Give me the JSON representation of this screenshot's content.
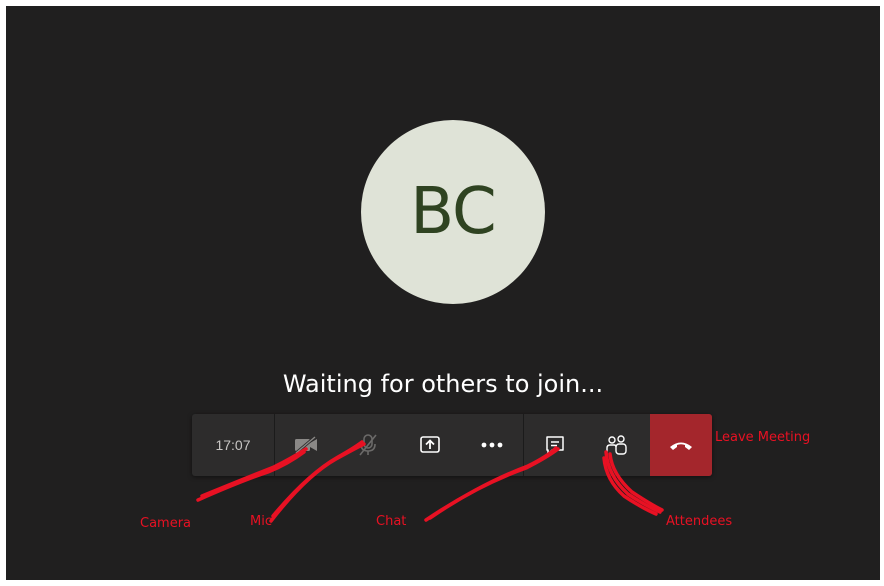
{
  "avatar": {
    "initials": "BC"
  },
  "status": {
    "waiting_text": "Waiting for others to join..."
  },
  "toolbar": {
    "timer": "17:07",
    "buttons": [
      {
        "name": "camera-off-icon"
      },
      {
        "name": "mic-off-icon"
      },
      {
        "name": "share-screen-icon"
      },
      {
        "name": "more-options-icon"
      },
      {
        "name": "chat-icon"
      },
      {
        "name": "attendees-icon"
      },
      {
        "name": "hang-up-icon"
      }
    ]
  },
  "annotations": {
    "camera": "Camera",
    "mic": "Mic",
    "chat": "Chat",
    "attendees": "Attendees",
    "leave": "Leave Meeting"
  },
  "colors": {
    "background": "#201f1f",
    "toolbar": "#2d2c2c",
    "avatar_bg": "#dfe3d7",
    "avatar_text": "#2f4321",
    "leave": "#a4262c",
    "annotation": "#e81123"
  }
}
